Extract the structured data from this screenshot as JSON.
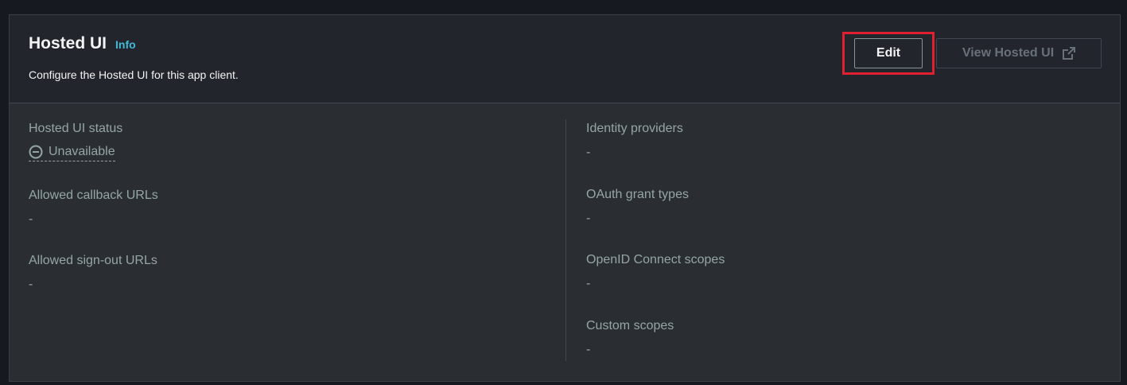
{
  "header": {
    "title": "Hosted UI",
    "info_label": "Info",
    "description": "Configure the Hosted UI for this app client.",
    "edit_label": "Edit",
    "view_label": "View Hosted UI"
  },
  "left_fields": {
    "status": {
      "label": "Hosted UI status",
      "value": "Unavailable"
    },
    "callback": {
      "label": "Allowed callback URLs",
      "value": "-"
    },
    "signout": {
      "label": "Allowed sign-out URLs",
      "value": "-"
    }
  },
  "right_fields": {
    "idp": {
      "label": "Identity providers",
      "value": "-"
    },
    "grant": {
      "label": "OAuth grant types",
      "value": "-"
    },
    "oidc": {
      "label": "OpenID Connect scopes",
      "value": "-"
    },
    "custom": {
      "label": "Custom scopes",
      "value": "-"
    }
  },
  "icons": {
    "status": "minus-circle-icon",
    "view": "external-link-icon"
  },
  "colors": {
    "background": "#16191f",
    "panel": "#2a2e33",
    "header": "#22262c",
    "info_link": "#44b9d6",
    "highlight": "#e02030"
  }
}
